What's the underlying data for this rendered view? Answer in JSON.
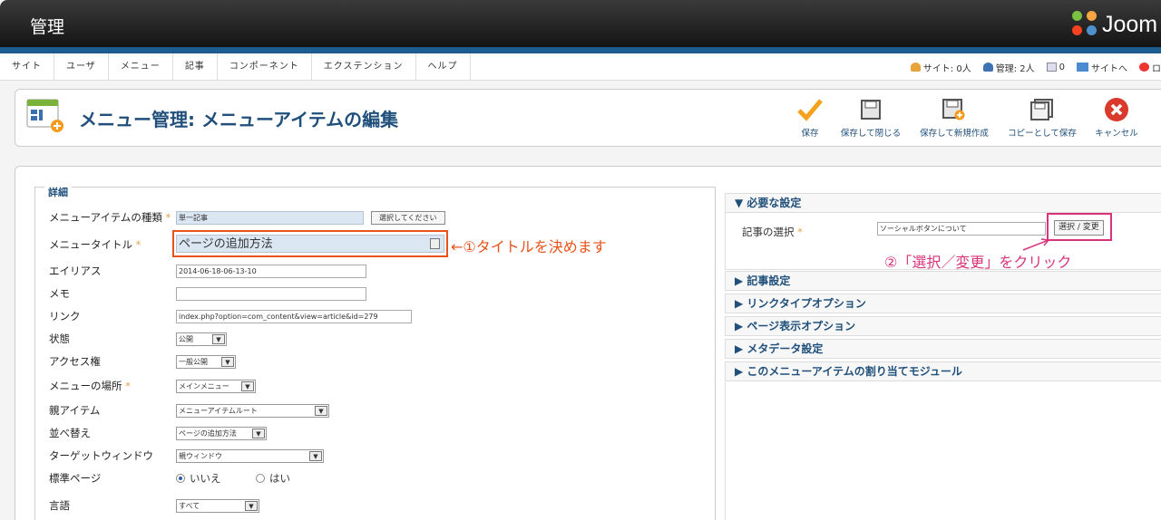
{
  "header": {
    "title": "管理",
    "logo_text": "Joom"
  },
  "menu": [
    "サイト",
    "ユーザ",
    "メニュー",
    "記事",
    "コンポーネント",
    "エクステンション",
    "ヘルプ"
  ],
  "status": {
    "site": "サイト: 0人",
    "admin": "管理: 2人",
    "messages": "0",
    "site_link": "サイトへ",
    "logout": "ロ"
  },
  "page": {
    "title": "メニュー管理: メニューアイテムの編集"
  },
  "toolbar": {
    "save": "保存",
    "save_close": "保存して閉じる",
    "save_new": "保存して新規作成",
    "save_copy": "コピーとして保存",
    "cancel": "キャンセル"
  },
  "details": {
    "legend": "詳細",
    "type_label": "メニューアイテムの種類",
    "type_value": "単一記事",
    "type_button": "選択してください",
    "title_label": "メニュータイトル",
    "title_value": "ページの追加方法",
    "alias_label": "エイリアス",
    "alias_value": "2014-06-18-06-13-10",
    "note_label": "メモ",
    "note_value": "",
    "link_label": "リンク",
    "link_value": "index.php?option=com_content&view=article&id=279",
    "state_label": "状態",
    "state_value": "公開",
    "access_label": "アクセス権",
    "access_value": "一般公開",
    "menu_label": "メニューの場所",
    "menu_value": "メインメニュー",
    "parent_label": "親アイテム",
    "parent_value": "メニューアイテムルート",
    "order_label": "並べ替え",
    "order_value": "ページの追加方法",
    "target_label": "ターゲットウィンドウ",
    "target_value": "親ウィンドウ",
    "home_label": "標準ページ",
    "home_no": "いいえ",
    "home_yes": "はい",
    "lang_label": "言語",
    "lang_value": "すべて"
  },
  "right": {
    "required_head": "必要な設定",
    "article_label": "記事の選択",
    "article_value": "ソーシャルボタンについて",
    "article_button": "選択 / 変更",
    "sections": [
      "記事設定",
      "リンクタイプオプション",
      "ページ表示オプション",
      "メタデータ設定",
      "このメニューアイテムの割り当てモジュール"
    ]
  },
  "annotations": {
    "a1": "←①タイトルを決めます",
    "a2": "②「選択／変更」をクリック"
  },
  "colors": {
    "annotation_orange": "#e8531b",
    "annotation_pink": "#d9337a",
    "header_blue": "#1d5c8f",
    "title_blue": "#1f4f7a"
  }
}
